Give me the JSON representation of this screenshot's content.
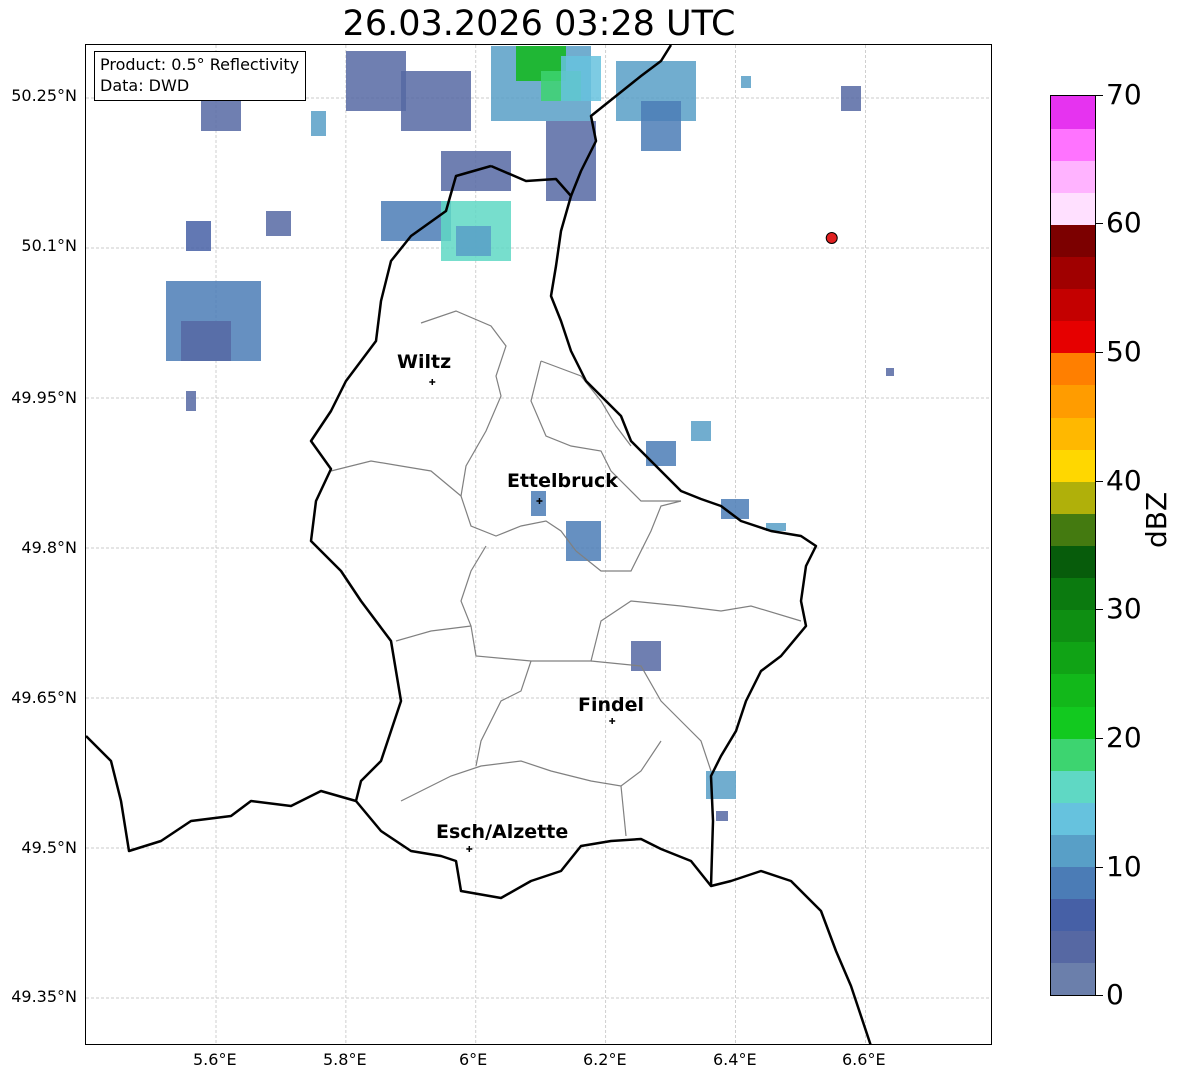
{
  "title": "26.03.2026 03:28 UTC",
  "info_box": {
    "product": "Product: 0.5° Reflectivity",
    "data": "Data: DWD"
  },
  "lat_labels": [
    "50.25°N",
    "50.1°N",
    "49.95°N",
    "49.8°N",
    "49.65°N",
    "49.5°N",
    "49.35°N"
  ],
  "lon_labels": [
    "5.6°E",
    "5.8°E",
    "6°E",
    "6.2°E",
    "6.4°E",
    "6.6°E"
  ],
  "cities": [
    {
      "name": "Wiltz",
      "lon": 5.933,
      "lat": 49.966
    },
    {
      "name": "Ettelbruck",
      "lon": 6.098,
      "lat": 49.847
    },
    {
      "name": "Findel",
      "lon": 6.21,
      "lat": 49.627
    },
    {
      "name": "Esch/Alzette",
      "lon": 5.99,
      "lat": 49.499
    }
  ],
  "radar_site": {
    "lon": 6.548,
    "lat": 50.11,
    "color": "#e02020"
  },
  "colorbar": {
    "label": "dBZ",
    "ticks": [
      "0",
      "10",
      "20",
      "30",
      "40",
      "50",
      "60",
      "70"
    ],
    "colors": [
      "#6b7fab",
      "#5668a3",
      "#4660a6",
      "#4b7cb6",
      "#589fc7",
      "#66c2de",
      "#5fd8c4",
      "#3dd470",
      "#12c91f",
      "#12b81a",
      "#10a315",
      "#0e8f12",
      "#0b7a0f",
      "#075c0b",
      "#447a10",
      "#b0b00a",
      "#ffd700",
      "#ffb800",
      "#ff9c00",
      "#ff7f00",
      "#e60000",
      "#c40000",
      "#a00000",
      "#7c0000",
      "#ffe0ff",
      "#ffb3ff",
      "#ff73ff",
      "#e633f0"
    ]
  },
  "colors": {
    "border": "#000000",
    "canton": "#808080",
    "grid": "#bbbbbb"
  }
}
